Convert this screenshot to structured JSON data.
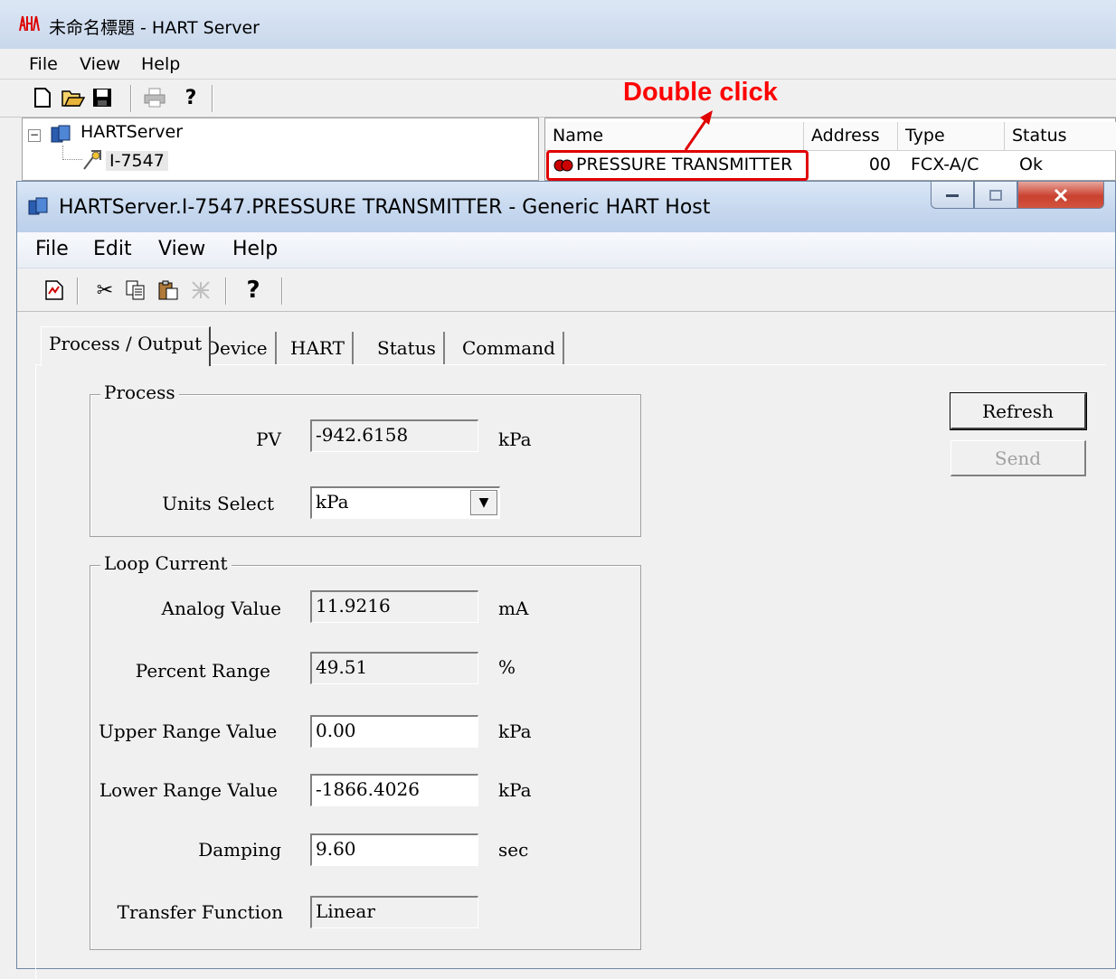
{
  "hart_server": {
    "title": "未命名標題 - HART Server",
    "menu": {
      "file": "File",
      "view": "View",
      "help": "Help"
    },
    "toolbar_icons": [
      "new-icon",
      "open-icon",
      "save-icon",
      "print-icon",
      "help-icon"
    ],
    "tree": {
      "root": "HARTServer",
      "child": "I-7547"
    },
    "list": {
      "columns": [
        "Name",
        "Address",
        "Type",
        "Status"
      ],
      "rows": [
        {
          "name": "PRESSURE TRANSMITTER",
          "address": "00",
          "type": "FCX-A/C",
          "status": "Ok"
        }
      ]
    }
  },
  "annotation": {
    "text": "Double click",
    "color": "#ff0000"
  },
  "host": {
    "title": "HARTServer.I-7547.PRESSURE TRANSMITTER - Generic HART Host",
    "menu": {
      "file": "File",
      "edit": "Edit",
      "view": "View",
      "help": "Help"
    },
    "toolbar_icons": [
      "report-icon",
      "cut-icon",
      "copy-icon",
      "paste-icon",
      "delete-icon",
      "help-icon"
    ],
    "tabs": [
      "Process / Output",
      "Device",
      "HART",
      "Status",
      "Command"
    ],
    "process": {
      "label": "Process",
      "pv": {
        "label": "PV",
        "value": "-942.6158",
        "unit": "kPa"
      },
      "units_select": {
        "label": "Units Select",
        "value": "kPa"
      }
    },
    "loop": {
      "label": "Loop Current",
      "analog": {
        "label": "Analog Value",
        "value": "11.9216",
        "unit": "mA"
      },
      "percent": {
        "label": "Percent Range",
        "value": "49.51",
        "unit": "%"
      },
      "urv": {
        "label": "Upper Range Value",
        "value": "0.00",
        "unit": "kPa"
      },
      "lrv": {
        "label": "Lower Range Value",
        "value": "-1866.4026",
        "unit": "kPa"
      },
      "damping": {
        "label": "Damping",
        "value": "9.60",
        "unit": "sec"
      },
      "transfer": {
        "label": "Transfer Function",
        "value": "Linear"
      }
    },
    "buttons": {
      "refresh": "Refresh",
      "send": "Send"
    }
  }
}
